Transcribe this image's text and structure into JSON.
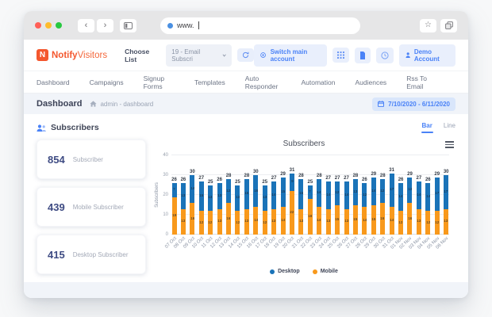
{
  "browser": {
    "url": "www.",
    "traffic_lights": [
      "#ff5f57",
      "#febc2e",
      "#28c840"
    ]
  },
  "header": {
    "logo_icon_letter": "N",
    "logo_bold": "Notify",
    "logo_light": "Visitors",
    "choose_list_label": "Choose List",
    "list_dropdown_value": "19 - Email Subscri",
    "switch_account_label": "Switch main account",
    "account_label": "Demo Account"
  },
  "nav": {
    "items": [
      "Dashboard",
      "Campaigns",
      "Signup Forms",
      "Templates",
      "Auto Responder",
      "Automation",
      "Audiences",
      "Rss To Email"
    ]
  },
  "breadcrumb": {
    "title": "Dashboard",
    "path": "admin - dashboard",
    "date_range": "7/10/2020 - 6/11/2020"
  },
  "section": {
    "title": "Subscribers",
    "toggle_bar": "Bar",
    "toggle_line": "Line"
  },
  "stats": [
    {
      "value": "854",
      "label": "Subscriber"
    },
    {
      "value": "439",
      "label": "Mobile Subscriber"
    },
    {
      "value": "415",
      "label": "Desktop Subscriber"
    }
  ],
  "colors": {
    "accent_blue": "#4a82f7",
    "brand_orange": "#f4572e",
    "stat_navy": "#3e4b83",
    "bar_desktop": "#1a73b8",
    "bar_mobile": "#f8991c"
  },
  "chart_data": {
    "type": "bar",
    "stacked": true,
    "title": "Subscribers",
    "xlabel": "",
    "ylabel": "Subscribers",
    "ylim": [
      0,
      40
    ],
    "yticks": [
      0,
      10,
      20,
      30,
      40
    ],
    "grid": true,
    "legend_position": "bottom",
    "categories": [
      "07 Oct",
      "08 Oct",
      "09 Oct",
      "10 Oct",
      "11 Oct",
      "12 Oct",
      "13 Oct",
      "14 Oct",
      "15 Oct",
      "16 Oct",
      "17 Oct",
      "18 Oct",
      "19 Oct",
      "20 Oct",
      "21 Oct",
      "22 Oct",
      "23 Oct",
      "24 Oct",
      "25 Oct",
      "26 Oct",
      "27 Oct",
      "28 Oct",
      "29 Oct",
      "30 Oct",
      "31 Oct",
      "01 Nov",
      "02 Nov",
      "03 Nov",
      "04 Nov",
      "05 Nov",
      "06 Nov"
    ],
    "series": [
      {
        "name": "Desktop",
        "color": "#1a73b8",
        "values": [
          7,
          13,
          14,
          15,
          13,
          13,
          12,
          13,
          15,
          16,
          13,
          14,
          15,
          9,
          15,
          7,
          14,
          14,
          12,
          14,
          13,
          12,
          14,
          12,
          17,
          14,
          13,
          14,
          14,
          17,
          17
        ]
      },
      {
        "name": "Mobile",
        "color": "#f8991c",
        "values": [
          19,
          13,
          16,
          12,
          12,
          13,
          16,
          12,
          13,
          14,
          12,
          13,
          14,
          22,
          13,
          18,
          14,
          13,
          15,
          13,
          15,
          14,
          15,
          16,
          14,
          12,
          16,
          13,
          12,
          12,
          13
        ]
      }
    ],
    "totals": [
      26,
      26,
      30,
      27,
      25,
      26,
      28,
      25,
      28,
      30,
      25,
      27,
      29,
      31,
      28,
      25,
      28,
      27,
      27,
      27,
      28,
      26,
      29,
      28,
      31,
      26,
      29,
      27,
      26,
      29,
      30
    ]
  }
}
